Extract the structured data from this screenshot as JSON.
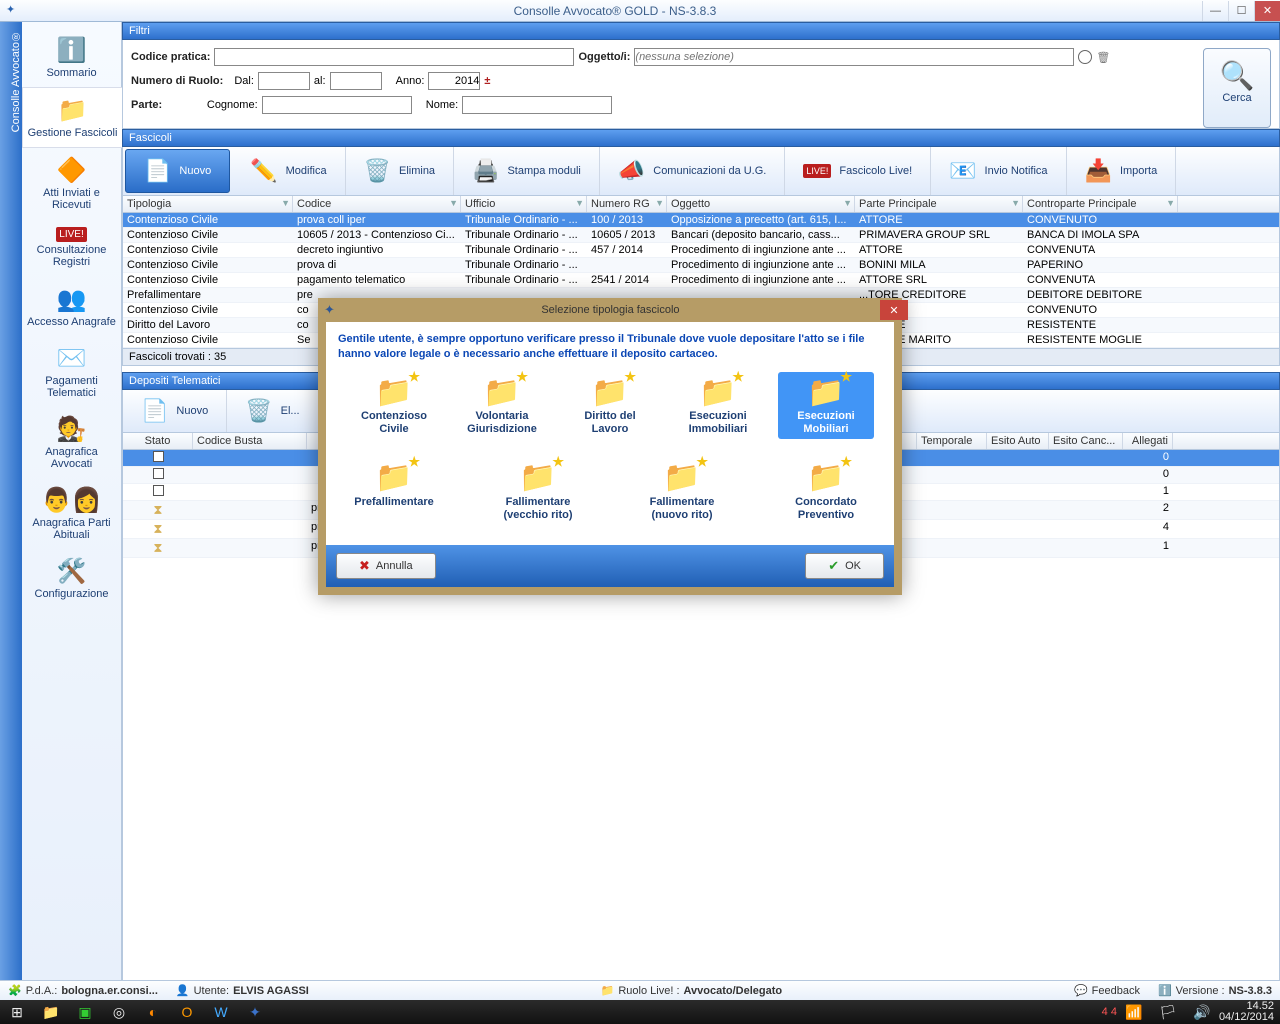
{
  "window": {
    "title": "Consolle Avvocato® GOLD - NS-3.8.3"
  },
  "wincontrols": {
    "min": "—",
    "max": "☐",
    "close": "✕"
  },
  "leftrail": "Consolle Avvocato®",
  "sidebar": [
    {
      "icon": "ℹ️",
      "label": "Sommario"
    },
    {
      "icon": "📁",
      "label": "Gestione Fascicoli"
    },
    {
      "icon": "🔶",
      "label": "Atti Inviati e Ricevuti"
    },
    {
      "icon": "LIVE!",
      "label": "Consultazione Registri"
    },
    {
      "icon": "👥",
      "label": "Accesso Anagrafe"
    },
    {
      "icon": "✉️",
      "label": "Pagamenti Telematici"
    },
    {
      "icon": "🧑‍⚖️",
      "label": "Anagrafica Avvocati"
    },
    {
      "icon": "👨‍👩‍",
      "label": "Anagrafica Parti Abituali"
    },
    {
      "icon": "🛠️",
      "label": "Configurazione"
    }
  ],
  "filters": {
    "head": "Filtri",
    "codice_label": "Codice pratica:",
    "oggetto_label": "Oggetto/i:",
    "oggetto_placeholder": "(nessuna selezione)",
    "numero_ruolo_label": "Numero di Ruolo:",
    "dal": "Dal:",
    "al": "al:",
    "anno": "Anno:",
    "anno_val": "2014",
    "parte": "Parte:",
    "cognome": "Cognome:",
    "nome": "Nome:",
    "search": "Cerca"
  },
  "fascicoli": {
    "head": "Fascicoli",
    "toolbar": [
      {
        "icon": "📄",
        "label": "Nuovo"
      },
      {
        "icon": "✏️",
        "label": "Modifica"
      },
      {
        "icon": "🗑️",
        "label": "Elimina"
      },
      {
        "icon": "🖨️",
        "label": "Stampa moduli"
      },
      {
        "icon": "📣",
        "label": "Comunicazioni da U.G."
      },
      {
        "icon": "LIVE!",
        "label": "Fascicolo Live!"
      },
      {
        "icon": "📧",
        "label": "Invio Notifica"
      },
      {
        "icon": "📥",
        "label": "Importa"
      }
    ],
    "cols": [
      "Tipologia",
      "Codice",
      "Ufficio",
      "Numero RG",
      "Oggetto",
      "Parte Principale",
      "Controparte Principale"
    ],
    "rows": [
      [
        "Contenzioso Civile",
        "prova coll iper",
        "Tribunale Ordinario - ...",
        "100 / 2013",
        "Opposizione a precetto (art. 615, I...",
        "ATTORE",
        "CONVENUTO"
      ],
      [
        "Contenzioso Civile",
        "10605 / 2013 - Contenzioso Ci...",
        "Tribunale Ordinario - ...",
        "10605 / 2013",
        "Bancari (deposito bancario, cass...",
        "PRIMAVERA GROUP SRL",
        "BANCA DI IMOLA SPA"
      ],
      [
        "Contenzioso Civile",
        "decreto ingiuntivo",
        "Tribunale Ordinario - ...",
        "457 / 2014",
        "Procedimento di ingiunzione ante ...",
        "ATTORE",
        "CONVENUTA"
      ],
      [
        "Contenzioso Civile",
        "prova di",
        "Tribunale Ordinario - ...",
        "",
        "Procedimento di ingiunzione ante ...",
        "BONINI MILA",
        "PAPERINO"
      ],
      [
        "Contenzioso Civile",
        "pagamento telematico",
        "Tribunale Ordinario - ...",
        "2541 / 2014",
        "Procedimento di ingiunzione ante ...",
        "ATTORE SRL",
        "CONVENUTA"
      ],
      [
        "Prefallimentare",
        "pre",
        "",
        "",
        "",
        "...TORE CREDITORE",
        "DEBITORE DEBITORE"
      ],
      [
        "Contenzioso Civile",
        "co",
        "",
        "",
        "",
        "...E",
        "CONVENUTO"
      ],
      [
        "Diritto del Lavoro",
        "co",
        "",
        "",
        "",
        "...RENTE",
        "RESISTENTE"
      ],
      [
        "Contenzioso Civile",
        "Se",
        "",
        "",
        "",
        "...RENTE MARITO",
        "RESISTENTE MOGLIE"
      ]
    ],
    "footer": "Fascicoli trovati :  35"
  },
  "depositi": {
    "head": "Depositi Telematici",
    "toolbar": [
      {
        "icon": "📄",
        "label": "Nuovo"
      },
      {
        "icon": "🗑️",
        "label": "El..."
      }
    ],
    "cols": [
      "Stato",
      "Codice Busta",
      "",
      "Temporale",
      "Esito Auto",
      "Esito Canc...",
      "Allegati"
    ],
    "rows": [
      {
        "stato": "chk",
        "codice": "",
        "desc": "",
        "alleg": "0"
      },
      {
        "stato": "chk",
        "codice": "",
        "desc": "",
        "alleg": "0"
      },
      {
        "stato": "chk",
        "codice": "",
        "desc": "",
        "alleg": "1"
      },
      {
        "stato": "hg",
        "codice": "",
        "desc": "prova coll iper - Memo",
        "alleg": "2"
      },
      {
        "stato": "hg",
        "codice": "",
        "desc": "prova coll iper - Memo",
        "alleg": "4"
      },
      {
        "stato": "hg",
        "codice": "",
        "desc": "prova coll iper - Memo",
        "alleg": "1"
      }
    ]
  },
  "modal": {
    "title": "Selezione tipologia fascicolo",
    "info": "Gentile utente, è sempre opportuno verificare presso il Tribunale dove vuole depositare l'atto se i file hanno valore legale o è necessario anche effettuare il deposito cartaceo.",
    "options": [
      "Contenzioso Civile",
      "Volontaria Giurisdizione",
      "Diritto del Lavoro",
      "Esecuzioni Immobiliari",
      "Esecuzioni Mobiliari",
      "Prefallimentare",
      "Fallimentare (vecchio rito)",
      "Fallimentare (nuovo rito)",
      "Concordato Preventivo"
    ],
    "selected": 4,
    "cancel": "Annulla",
    "ok": "OK"
  },
  "status": {
    "pda_label": "P.d.A.:",
    "pda": "bologna.er.consi...",
    "utente_label": "Utente:",
    "utente": "ELVIS AGASSI",
    "ruolo_label": "Ruolo Live! :",
    "ruolo": "Avvocato/Delegato",
    "feedback": "Feedback",
    "versione_label": "Versione :",
    "versione": "NS-3.8.3"
  },
  "taskbar": {
    "time": "14.52",
    "date": "04/12/2014",
    "44": "4 4"
  }
}
